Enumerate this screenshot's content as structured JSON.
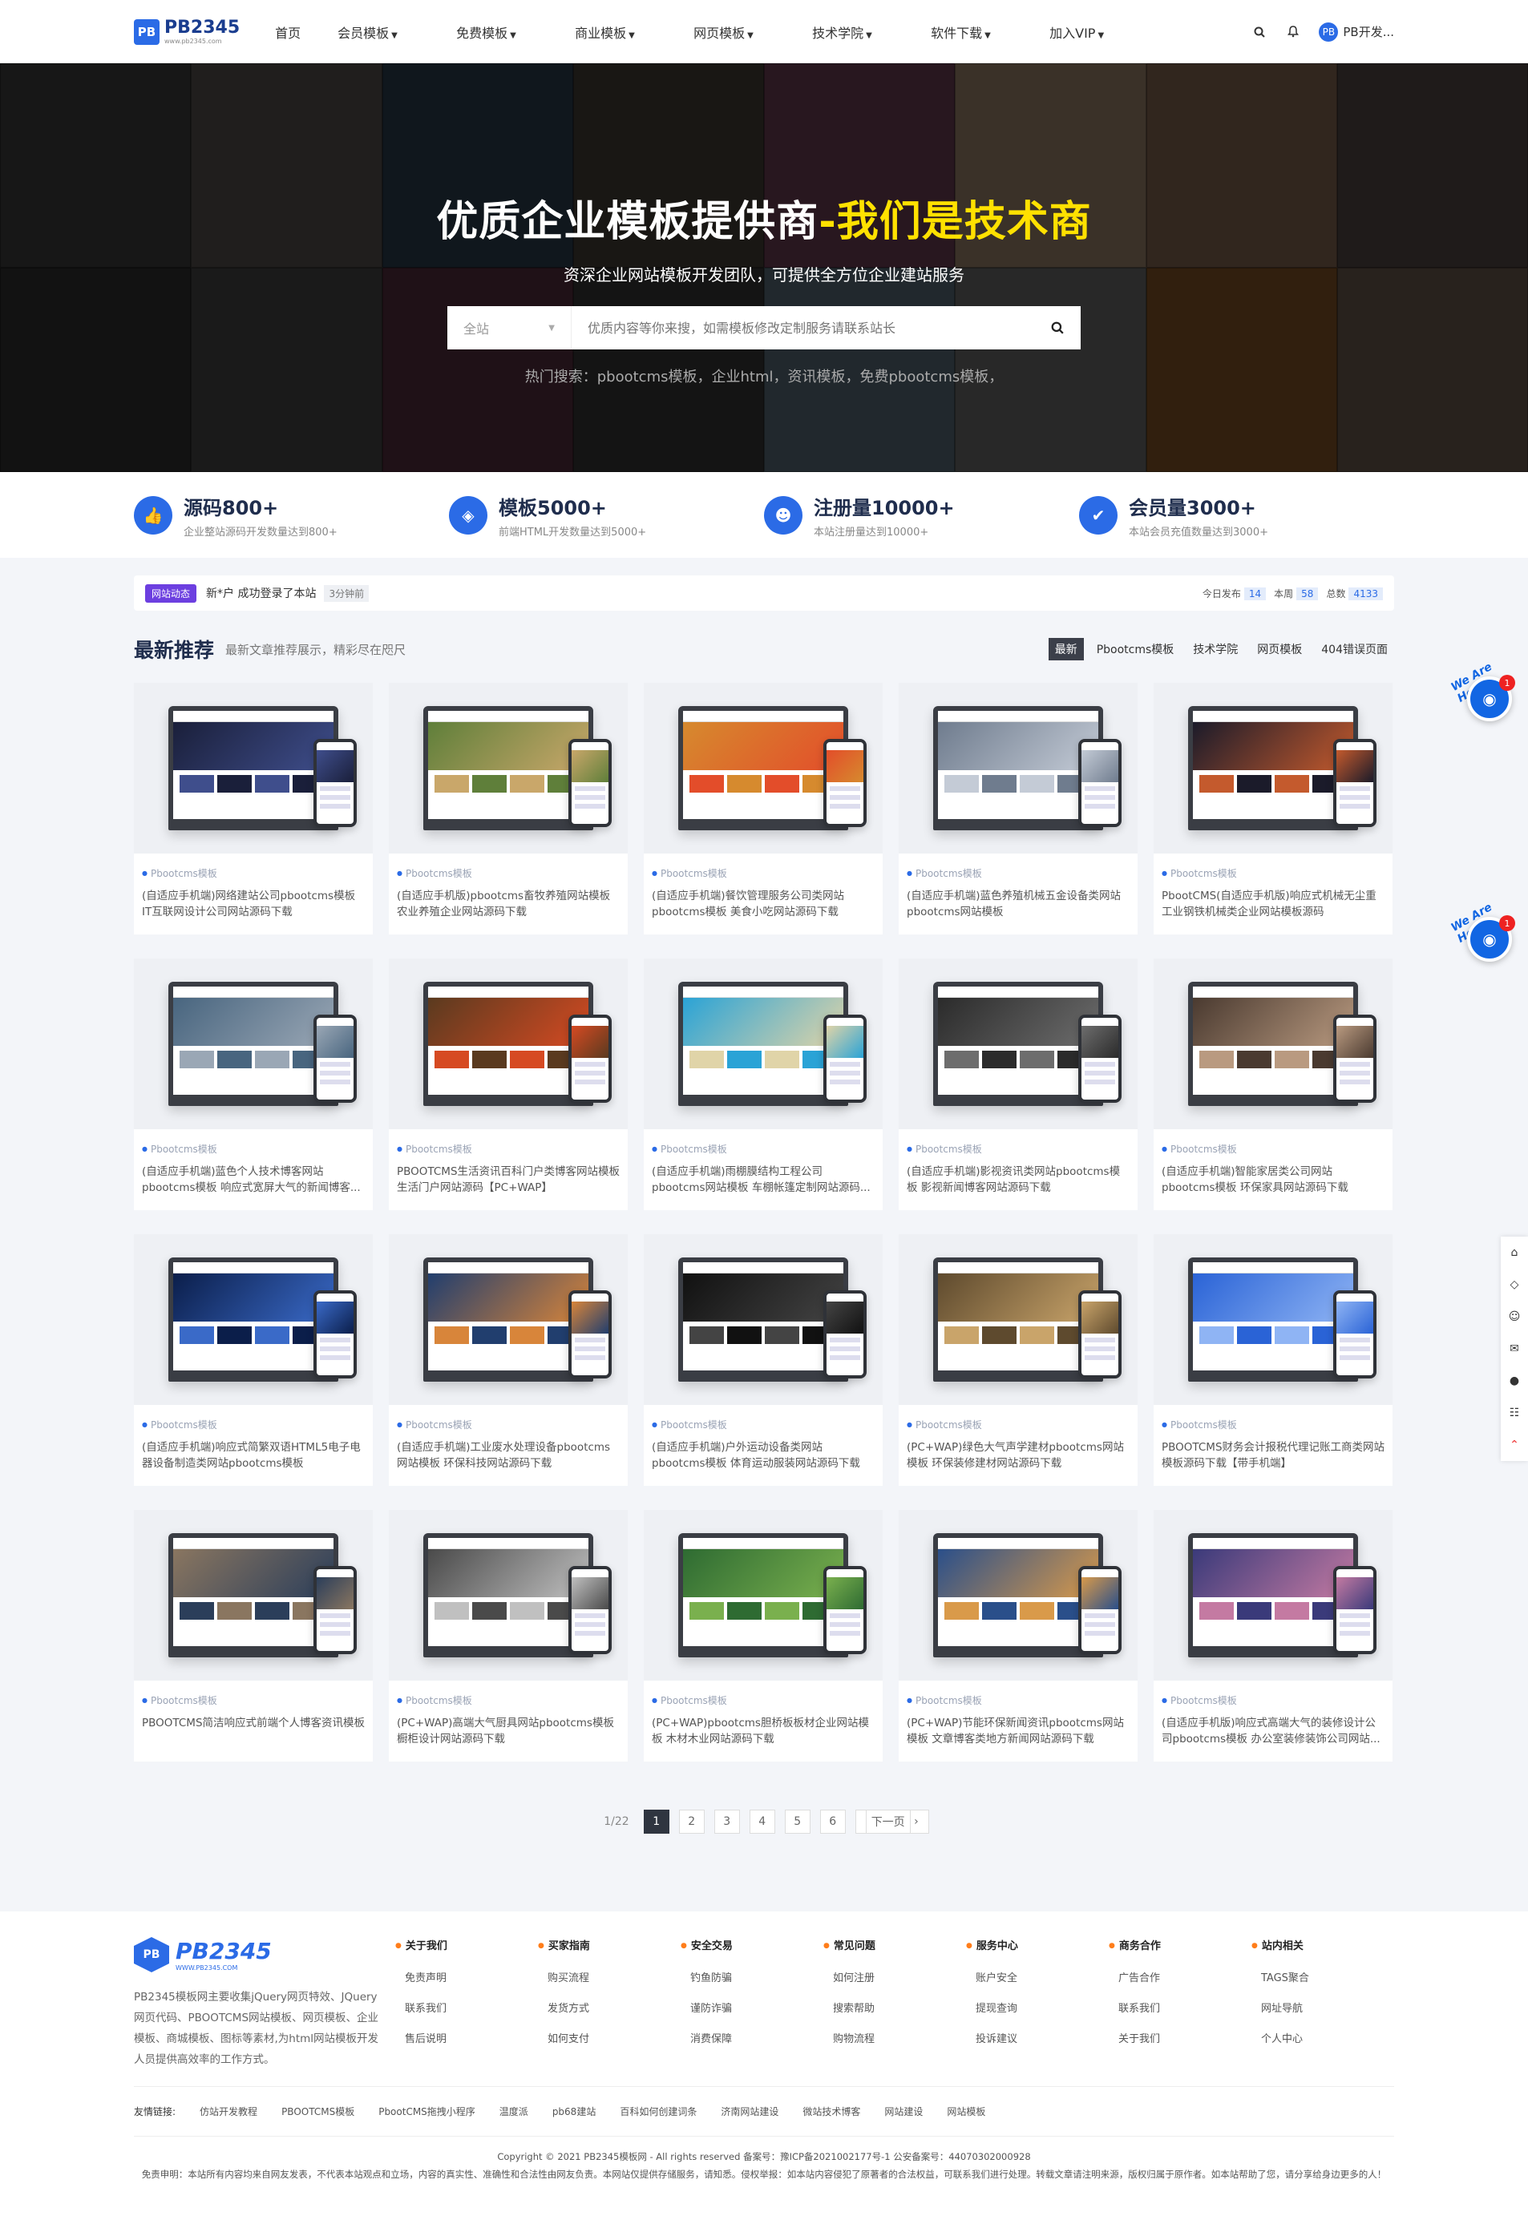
{
  "header": {
    "logo_text": "PB2345",
    "logo_sub": "www.pb2345.com",
    "nav": [
      "首页",
      "会员模板",
      "免费模板",
      "商业模板",
      "网页模板",
      "技术学院",
      "软件下载",
      "加入VIP"
    ],
    "user_name": "PB开发..."
  },
  "banner": {
    "title_main": "优质企业模板提供商",
    "title_accent": "-我们是技术商",
    "subtitle": "资深企业网站模板开发团队，可提供全方位企业建站服务",
    "search_scope": "全站",
    "search_placeholder": "优质内容等你来搜，如需模板修改定制服务请联系站长",
    "hot_search": "热门搜索：pbootcms模板，企业html，资讯模板，免费pbootcms模板，"
  },
  "stats": [
    {
      "num": "源码800+",
      "desc": "企业整站源码开发数量达到800+",
      "icon": "thumbs-up-icon"
    },
    {
      "num": "模板5000+",
      "desc": "前端HTML开发数量达到5000+",
      "icon": "shield-icon"
    },
    {
      "num": "注册量10000+",
      "desc": "本站注册量达到10000+",
      "icon": "user-icon"
    },
    {
      "num": "会员量3000+",
      "desc": "本站会员充值数量达到3000+",
      "icon": "user-check-icon"
    }
  ],
  "dynamic": {
    "tag": "网站动态",
    "text": "新*户 成功登录了本站",
    "time": "3分钟前",
    "today_label": "今日发布",
    "today_val": "14",
    "week_label": "本周",
    "week_val": "58",
    "total_label": "总数",
    "total_val": "4133"
  },
  "section": {
    "title": "最新推荐",
    "subtitle": "最新文章推荐展示，精彩尽在咫尺",
    "tabs": [
      "最新",
      "Pbootcms模板",
      "技术学院",
      "网页模板",
      "404错误页面"
    ]
  },
  "cards": [
    {
      "cat": "Pbootcms模板",
      "title": "(自适应手机端)网络建站公司pbootcms模板 IT互联网设计公司网站源码下载",
      "c1": "#1a1f3a",
      "c2": "#3f4e8c"
    },
    {
      "cat": "Pbootcms模板",
      "title": "(自适应手机版)pbootcms畜牧养殖网站模板 农业养殖企业网站源码下载",
      "c1": "#5f7f3a",
      "c2": "#c9a76a"
    },
    {
      "cat": "Pbootcms模板",
      "title": "(自适应手机端)餐饮管理服务公司类网站pbootcms模板 美食小吃网站源码下载",
      "c1": "#d68a2e",
      "c2": "#e34d2a"
    },
    {
      "cat": "Pbootcms模板",
      "title": "(自适应手机端)蓝色养殖机械五金设备类网站pbootcms网站模板",
      "c1": "#6f7c8e",
      "c2": "#c4cbd6"
    },
    {
      "cat": "Pbootcms模板",
      "title": "PbootCMS(自适应手机版)响应式机械无尘重工业钢铁机械类企业网站模板源码",
      "c1": "#1b1b2a",
      "c2": "#c45a2d"
    },
    {
      "cat": "Pbootcms模板",
      "title": "(自适应手机端)蓝色个人技术博客网站pbootcms模板 响应式宽屏大气的新闻博客...",
      "c1": "#48657f",
      "c2": "#9aa7b5"
    },
    {
      "cat": "Pbootcms模板",
      "title": "PBOOTCMS生活资讯百科门户类博客网站模板生活门户网站源码【PC+WAP】",
      "c1": "#5a3a1f",
      "c2": "#d64a22"
    },
    {
      "cat": "Pbootcms模板",
      "title": "(自适应手机端)雨棚膜结构工程公司pbootcms网站模板 车棚帐篷定制网站源码...",
      "c1": "#2aa3d6",
      "c2": "#e0d4a8"
    },
    {
      "cat": "Pbootcms模板",
      "title": "(自适应手机端)影视资讯类网站pbootcms模板 影视新闻博客网站源码下载",
      "c1": "#2b2b2b",
      "c2": "#6d6d6d"
    },
    {
      "cat": "Pbootcms模板",
      "title": "(自适应手机端)智能家居类公司网站pbootcms模板 环保家具网站源码下载",
      "c1": "#4a3a30",
      "c2": "#b99a80"
    },
    {
      "cat": "Pbootcms模板",
      "title": "(自适应手机端)响应式简繁双语HTML5电子电器设备制造类网站pbootcms模板",
      "c1": "#0b1e4a",
      "c2": "#3a6ac8"
    },
    {
      "cat": "Pbootcms模板",
      "title": "(自适应手机端)工业废水处理设备pbootcms网站模板 环保科技网站源码下载",
      "c1": "#213e6e",
      "c2": "#d8853a"
    },
    {
      "cat": "Pbootcms模板",
      "title": "(自适应手机端)户外运动设备类网站pbootcms模板 体育运动服装网站源码下载",
      "c1": "#111111",
      "c2": "#444444"
    },
    {
      "cat": "Pbootcms模板",
      "title": "(PC+WAP)绿色大气声学建材pbootcms网站模板 环保装修建材网站源码下载",
      "c1": "#5e4a2e",
      "c2": "#c9a46a"
    },
    {
      "cat": "Pbootcms模板",
      "title": "PBOOTCMS财务会计报税代理记账工商类网站模板源码下载【带手机端】",
      "c1": "#2a63d6",
      "c2": "#8fb4f4"
    },
    {
      "cat": "Pbootcms模板",
      "title": "PBOOTCMS简洁响应式前端个人博客资讯模板",
      "c1": "#8a7660",
      "c2": "#2b3e5a"
    },
    {
      "cat": "Pbootcms模板",
      "title": "(PC+WAP)高端大气厨具网站pbootcms模板 橱柜设计网站源码下载",
      "c1": "#4a4a4a",
      "c2": "#c0c0c0"
    },
    {
      "cat": "Pbootcms模板",
      "title": "(PC+WAP)pbootcms胆桥板板材企业网站模板 木材木业网站源码下载",
      "c1": "#2e6b32",
      "c2": "#7ab04e"
    },
    {
      "cat": "Pbootcms模板",
      "title": "(PC+WAP)节能环保新闻资讯pbootcms网站模板 文章博客类地方新闻网站源码下载",
      "c1": "#2a4f8a",
      "c2": "#d99a4a"
    },
    {
      "cat": "Pbootcms模板",
      "title": "(自适应手机版)响应式高端大气的装修设计公司pbootcms模板 办公室装修装饰公司网站...",
      "c1": "#3a3a7a",
      "c2": "#c47aa2"
    }
  ],
  "pager": {
    "total": "1/22",
    "pages": [
      "1",
      "2",
      "3",
      "4",
      "5",
      "6"
    ],
    "next": "下一页"
  },
  "chat": {
    "badge": "1",
    "text": "We Are Here!"
  },
  "footer": {
    "logo_text": "PB2345",
    "logo_sub": "WWW.PB2345.COM",
    "desc": "PB2345模板网主要收集jQuery网页特效、JQuery网页代码、PBOOTCMS网站模板、网页模板、企业模板、商城模板、图标等素材,为html网站模板开发人员提供高效率的工作方式。",
    "cols": [
      {
        "title": "关于我们",
        "items": [
          "免责声明",
          "联系我们",
          "售后说明"
        ]
      },
      {
        "title": "买家指南",
        "items": [
          "购买流程",
          "发货方式",
          "如何支付"
        ]
      },
      {
        "title": "安全交易",
        "items": [
          "钓鱼防骗",
          "谨防诈骗",
          "消费保障"
        ]
      },
      {
        "title": "常见问题",
        "items": [
          "如何注册",
          "搜索帮助",
          "购物流程"
        ]
      },
      {
        "title": "服务中心",
        "items": [
          "账户安全",
          "提现查询",
          "投诉建议"
        ]
      },
      {
        "title": "商务合作",
        "items": [
          "广告合作",
          "联系我们",
          "关于我们"
        ]
      },
      {
        "title": "站内相关",
        "items": [
          "TAGS聚合",
          "网址导航",
          "个人中心"
        ]
      }
    ],
    "links_label": "友情链接:",
    "links": [
      "仿站开发教程",
      "PBOOTCMS模板",
      "PbootCMS拖拽小程序",
      "温度派",
      "pb68建站",
      "百科如何创建词条",
      "济南网站建设",
      "微站技术博客",
      "网站建设",
      "网站模板"
    ],
    "copyright": "Copyright © 2021  PB2345模板网  - All rights reserved  备案号：豫ICP备2021002177号-1    公安备案号：44070302000928",
    "disclaimer": "免责申明：本站所有内容均来自网友发表，不代表本站观点和立场，内容的真实性、准确性和合法性由网友负责。本网站仅提供存储服务，请知悉。侵权举报：如本站内容侵犯了原著者的合法权益，可联系我们进行处理。转载文章请注明来源，版权归属于原作者。如本站帮助了您，请分享给身边更多的人！"
  }
}
